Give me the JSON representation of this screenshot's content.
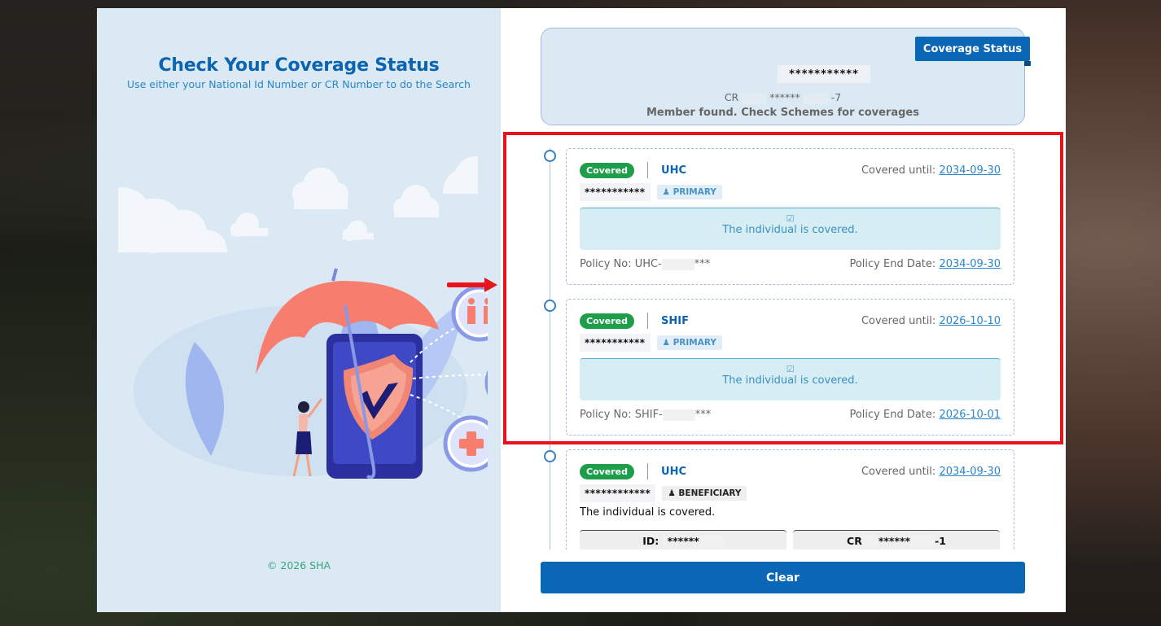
{
  "left": {
    "title": "Check Your Coverage Status",
    "subtitle": "Use either your National Id Number or CR Number to do the Search",
    "footer": "© 2026 SHA"
  },
  "status": {
    "badge": "Coverage Status",
    "masked_id": "***********",
    "cr_prefix": "CR",
    "cr_mask": "******",
    "cr_suffix": "-7",
    "message": "Member found. Check Schemes for coverages"
  },
  "coverages": [
    {
      "status": "Covered",
      "scheme": "UHC",
      "until_label": "Covered until:",
      "until_date": "2034-09-30",
      "masked_name": "***********",
      "role": "PRIMARY",
      "covered_icon": "check-square-icon",
      "message": "The individual is covered.",
      "policy_label": "Policy No: UHC-",
      "policy_suffix": "***",
      "end_label": "Policy End Date:",
      "end_date": "2034-09-30"
    },
    {
      "status": "Covered",
      "scheme": "SHIF",
      "until_label": "Covered until:",
      "until_date": "2026-10-10",
      "masked_name": "***********",
      "role": "PRIMARY",
      "covered_icon": "check-square-icon",
      "message": "The individual is covered.",
      "policy_label": "Policy No: SHIF-",
      "policy_suffix": "***",
      "end_label": "Policy End Date:",
      "end_date": "2026-10-01"
    },
    {
      "status": "Covered",
      "scheme": "UHC",
      "until_label": "Covered until:",
      "until_date": "2034-09-30",
      "masked_name": "************",
      "role": "BENEFICIARY",
      "message": "The individual is covered.",
      "id_label": "ID:",
      "id_mask": "******",
      "cr_label": "CR",
      "cr_mask": "******",
      "cr_suffix": "-1"
    }
  ],
  "actions": {
    "clear": "Clear"
  },
  "colors": {
    "primary": "#0a67b5",
    "success": "#1e9e4a",
    "highlight": "#e8131b"
  }
}
